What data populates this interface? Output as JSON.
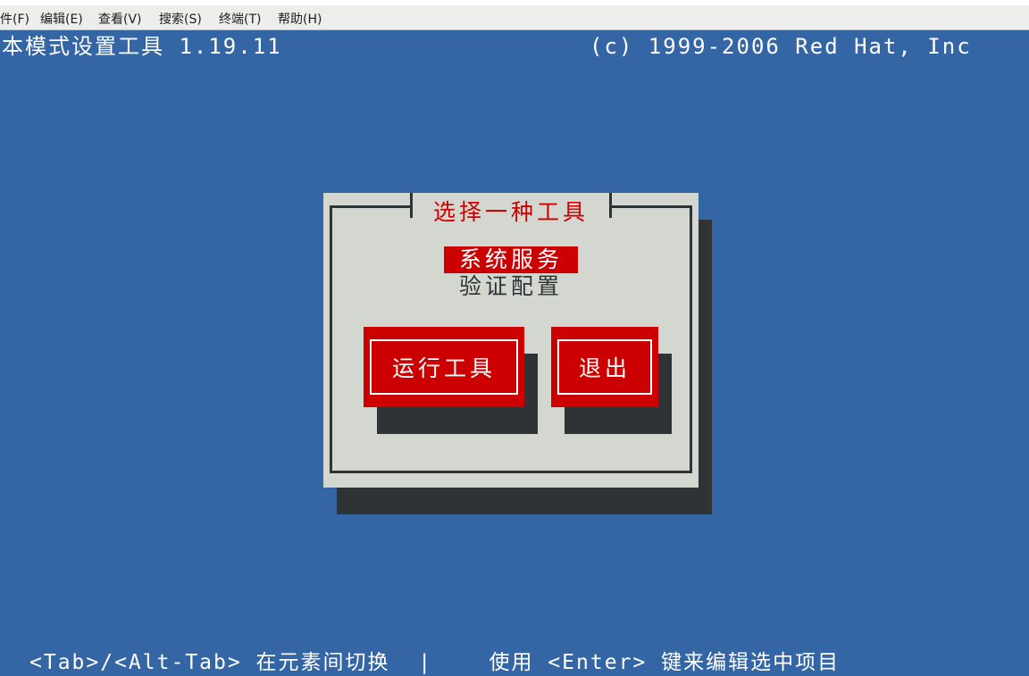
{
  "menubar": {
    "items": [
      "件(F)",
      "编辑(E)",
      "查看(V)",
      "搜索(S)",
      "终端(T)",
      "帮助(H)"
    ]
  },
  "header": {
    "title": "本模式设置工具 1.19.11",
    "copyright": "(c) 1999-2006 Red Hat, Inc"
  },
  "dialog": {
    "title": "选择一种工具",
    "list": [
      {
        "label": "系统服务",
        "selected": true
      },
      {
        "label": "验证配置",
        "selected": false
      }
    ],
    "buttons": {
      "run": "运行工具",
      "quit": "退出"
    }
  },
  "footer": {
    "help": "<Tab>/<Alt-Tab> 在元素间切换  |    使用 <Enter> 键来编辑选中项目"
  },
  "colors": {
    "background": "#3465a4",
    "dialog": "#d3d7cf",
    "accent": "#cc0000",
    "shadow": "#2e3436"
  }
}
